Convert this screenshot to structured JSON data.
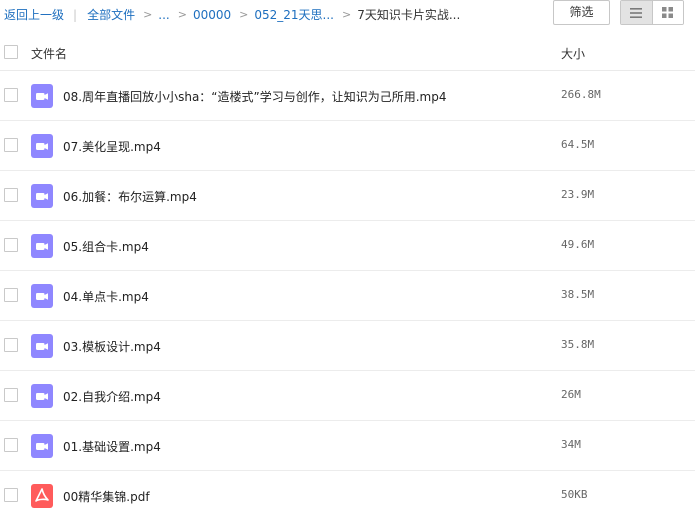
{
  "breadcrumb": {
    "back": "返回上一级",
    "all_files": "全部文件",
    "ellipsis": "...",
    "level1": "00000",
    "level2": "052_21天思...",
    "current": "7天知识卡片实战..."
  },
  "toolbar": {
    "filter_label": "筛选",
    "views": [
      "list-view-icon",
      "grid-view-icon"
    ],
    "active_view": "list"
  },
  "table": {
    "col_name": "文件名",
    "col_size": "大小"
  },
  "files": [
    {
      "name": "08.周年直播回放小小sha：“造楼式”学习与创作，让知识为己所用.mp4",
      "size": "266.8M",
      "type": "video-file-icon"
    },
    {
      "name": "07.美化呈现.mp4",
      "size": "64.5M",
      "type": "video-file-icon"
    },
    {
      "name": "06.加餐：布尔运算.mp4",
      "size": "23.9M",
      "type": "video-file-icon"
    },
    {
      "name": "05.组合卡.mp4",
      "size": "49.6M",
      "type": "video-file-icon"
    },
    {
      "name": "04.单点卡.mp4",
      "size": "38.5M",
      "type": "video-file-icon"
    },
    {
      "name": "03.模板设计.mp4",
      "size": "35.8M",
      "type": "video-file-icon"
    },
    {
      "name": "02.自我介绍.mp4",
      "size": "26M",
      "type": "video-file-icon"
    },
    {
      "name": "01.基础设置.mp4",
      "size": "34M",
      "type": "video-file-icon"
    },
    {
      "name": "00精华集锦.pdf",
      "size": "50KB",
      "type": "pdf-file-icon"
    }
  ],
  "colors": {
    "link": "#1e6fbf",
    "video_icon": "#8f87ff",
    "pdf_icon": "#ff5b5b"
  }
}
